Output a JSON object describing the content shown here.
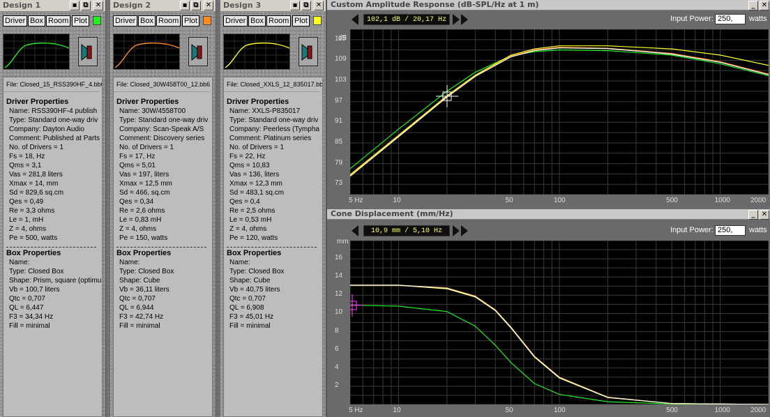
{
  "designs": [
    {
      "title": "Design 1",
      "buttons": [
        "Driver",
        "Box",
        "Room",
        "Plot"
      ],
      "color": "#22ee22",
      "file": "File: Closed_15_RSS390HF_4.bb6",
      "driver_header": "Driver Properties",
      "driver": [
        "Name: RSS390HF-4  publish",
        "Type: Standard one-way driv",
        "Company: Dayton Audio",
        "Comment: Published at Parts",
        "No. of Drivers = 1",
        "Fs = 18, Hz",
        "Qms = 3,1",
        "Vas = 281,8 liters",
        "Xmax = 14, mm",
        "Sd = 829,6 sq.cm",
        "Qes = 0,49",
        "Re = 3,3 ohms",
        "Le = 1, mH",
        "Z = 4, ohms",
        "Pe = 500, watts"
      ],
      "box_header": "Box Properties",
      "box": [
        "Name:",
        "Type: Closed Box",
        "Shape: Prism, square (optimu",
        "Vb = 100,7 liters",
        "Qtc = 0,707",
        "QL = 6,447",
        "F3 = 34,34 Hz",
        "Fill = minimal"
      ]
    },
    {
      "title": "Design 2",
      "buttons": [
        "Driver",
        "Box",
        "Room",
        "Plot"
      ],
      "color": "#ff8a1e",
      "file": "File: Closed_30W458T00_12.bb6",
      "driver_header": "Driver Properties",
      "driver": [
        "Name: 30W/4558T00",
        "Type: Standard one-way driv",
        "Company: Scan-Speak A/S",
        "Comment: Discovery series",
        "No. of Drivers = 1",
        "Fs = 17, Hz",
        "Qms = 5,01",
        "Vas = 197, liters",
        "Xmax = 12,5 mm",
        "Sd = 466, sq.cm",
        "Qes = 0,34",
        "Re = 2,6 ohms",
        "Le = 0,83 mH",
        "Z = 4, ohms",
        "Pe = 150, watts"
      ],
      "box_header": "Box Properties",
      "box": [
        "Name:",
        "Type: Closed Box",
        "Shape: Cube",
        "Vb = 36,11 liters",
        "Qtc = 0,707",
        "QL = 6,944",
        "F3 = 42,74 Hz",
        "Fill = minimal"
      ]
    },
    {
      "title": "Design 3",
      "buttons": [
        "Driver",
        "Box",
        "Room",
        "Plot"
      ],
      "color": "#ffff22",
      "file": "File: Closed_XXLS_12_835017.bb6",
      "driver_header": "Driver Properties",
      "driver": [
        "Name: XXLS-P835017",
        "Type: Standard one-way driv",
        "Company: Peerless  (Tympha",
        "Comment: Platinum series",
        "No. of Drivers = 1",
        "Fs = 22, Hz",
        "Qms = 10,83",
        "Vas = 136, liters",
        "Xmax = 12,3 mm",
        "Sd = 483,1 sq.cm",
        "Qes = 0,4",
        "Re = 2,5 ohms",
        "Le = 0,53 mH",
        "Z = 4, ohms",
        "Pe = 120, watts"
      ],
      "box_header": "Box Properties",
      "box": [
        "Name:",
        "Type: Closed Box",
        "Shape: Cube",
        "Vb = 40,75 liters",
        "Qtc = 0,707",
        "QL = 6,908",
        "F3 = 45,01 Hz",
        "Fill = minimal"
      ]
    }
  ],
  "window_buttons": {
    "save": "▪",
    "copy": "⧉",
    "close": "✕",
    "minimize": "_"
  },
  "spl_panel": {
    "title": "Custom Amplitude Response (dB-SPL/Hz at 1 m)",
    "readout": "102,1 dB / 20,17 Hz",
    "input_power_label": "Input Power:",
    "input_power_value": "250,",
    "input_power_unit": "watts"
  },
  "disp_panel": {
    "title": "Cone Displacement (mm/Hz)",
    "readout": "10,9 mm / 5,10 Hz",
    "input_power_label": "Input Power:",
    "input_power_value": "250,",
    "input_power_unit": "watts"
  },
  "chart_data": [
    {
      "type": "line",
      "title": "Custom Amplitude Response (dB-SPL/Hz at 1 m)",
      "ylabel": "dB",
      "xscale": "log",
      "xlim": [
        5,
        2000
      ],
      "ylim": [
        70,
        118
      ],
      "xticks": [
        5,
        10,
        50,
        100,
        500,
        1000,
        2000
      ],
      "xtick_labels": [
        "5 Hz",
        "10",
        "50",
        "100",
        "500",
        "1000",
        "2000"
      ],
      "yticks": [
        73,
        79,
        85,
        91,
        97,
        103,
        109,
        115
      ],
      "grid": true,
      "series": [
        {
          "color": "#22ee22",
          "x": [
            5,
            10,
            20,
            30,
            50,
            70,
            100,
            200,
            500,
            1000,
            2000
          ],
          "y": [
            77.5,
            89,
            100,
            105.5,
            110.3,
            111.5,
            112,
            111.8,
            110.5,
            108,
            104.5
          ]
        },
        {
          "color": "#ff8a1e",
          "x": [
            5,
            10,
            20,
            30,
            50,
            70,
            100,
            200,
            500,
            1000,
            2000
          ],
          "y": [
            75.5,
            87,
            98.5,
            104.5,
            110.2,
            112,
            112.8,
            112.5,
            111,
            108.6,
            105
          ]
        },
        {
          "color": "#ffff22",
          "x": [
            5,
            10,
            20,
            30,
            50,
            70,
            100,
            200,
            500,
            1000,
            2000
          ],
          "y": [
            75.8,
            87.2,
            98.7,
            104.7,
            110.5,
            112.3,
            113.2,
            113.2,
            112.3,
            110.5,
            107.5
          ]
        },
        {
          "color": "#ffffff",
          "x": [
            5,
            10,
            20,
            30,
            50,
            70,
            100,
            200,
            500,
            1000,
            2000
          ],
          "y": [
            75.3,
            86.8,
            98.3,
            104.3,
            110,
            111.8,
            112.6,
            112.4,
            110.8,
            108.4,
            104.8
          ]
        }
      ]
    },
    {
      "type": "line",
      "title": "Cone Displacement (mm/Hz)",
      "ylabel": "mm",
      "xscale": "log",
      "xlim": [
        5,
        2000
      ],
      "ylim": [
        0,
        18
      ],
      "xticks": [
        5,
        10,
        50,
        100,
        500,
        1000,
        2000
      ],
      "xtick_labels": [
        "5 Hz",
        "10",
        "50",
        "100",
        "500",
        "1000",
        "2000"
      ],
      "yticks": [
        2,
        4,
        6,
        8,
        10,
        12,
        14,
        16
      ],
      "grid": true,
      "series": [
        {
          "color": "#22ee22",
          "x": [
            5,
            10,
            20,
            30,
            40,
            50,
            70,
            100,
            200,
            500,
            2000
          ],
          "y": [
            10.9,
            10.8,
            10.2,
            8.6,
            6.5,
            4.6,
            2.3,
            1.1,
            0.3,
            0.05,
            0
          ]
        },
        {
          "color": "#ff8a1e",
          "x": [
            5,
            10,
            20,
            30,
            40,
            50,
            70,
            100,
            200,
            500,
            2000
          ],
          "y": [
            13.1,
            13.1,
            12.8,
            11.9,
            10.4,
            8.5,
            5.3,
            3,
            0.8,
            0.1,
            0
          ]
        },
        {
          "color": "#ffff22",
          "x": [
            5,
            10,
            20,
            30,
            40,
            50,
            70,
            100,
            200,
            500,
            2000
          ],
          "y": [
            13.1,
            13.1,
            12.7,
            11.8,
            10.3,
            8.4,
            5.2,
            2.9,
            0.75,
            0.1,
            0
          ]
        },
        {
          "color": "#ffffff",
          "x": [
            5,
            10,
            20,
            30,
            40,
            50,
            70,
            100,
            200,
            500,
            2000
          ],
          "y": [
            13.1,
            13.1,
            12.75,
            11.85,
            10.35,
            8.45,
            5.25,
            2.95,
            0.78,
            0.1,
            0
          ]
        }
      ]
    }
  ]
}
